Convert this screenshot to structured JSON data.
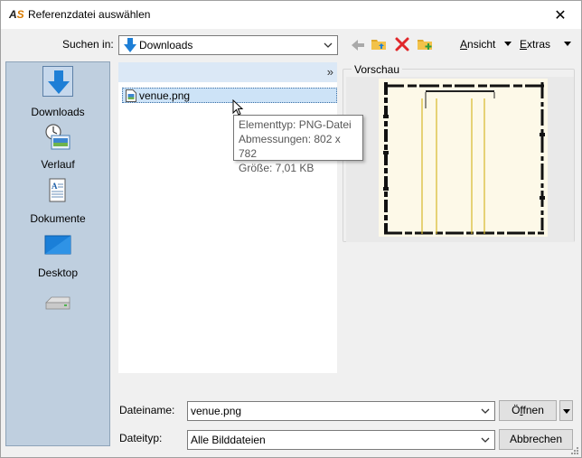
{
  "window": {
    "title": "Referenzdatei auswählen",
    "close_glyph": "✕"
  },
  "toolbar": {
    "look_in_label": "Suchen in:",
    "look_in_value": "Downloads",
    "view_label": "Ansicht",
    "view_mnemonic": "A",
    "view_rest": "nsicht",
    "tools_mnemonic": "E",
    "tools_rest": "xtras",
    "tools_label": "Extras"
  },
  "places": [
    {
      "label": "Downloads",
      "icon": "downloads-arrow-icon",
      "selected": true
    },
    {
      "label": "Verlauf",
      "icon": "history-clock-icon",
      "selected": false
    },
    {
      "label": "Dokumente",
      "icon": "documents-icon",
      "selected": false
    },
    {
      "label": "Desktop",
      "icon": "desktop-icon",
      "selected": false
    },
    {
      "label": "",
      "icon": "drive-icon",
      "selected": false
    }
  ],
  "filelist": {
    "header_chevron": "»",
    "files": [
      {
        "name": "venue.png",
        "icon": "png-file-icon",
        "selected": true
      }
    ]
  },
  "tooltip": {
    "line1": "Elementtyp: PNG-Datei",
    "line2": "Abmessungen: 802 x 782",
    "line3": "Größe: 7,01 KB"
  },
  "preview": {
    "label": "Vorschau"
  },
  "bottom": {
    "filename_label": "Dateiname:",
    "filename_value": "venue.png",
    "filetype_label": "Dateityp:",
    "filetype_value": "Alle Bilddateien",
    "open_mnemonic": "f",
    "open_pre": "Ö",
    "open_post": "fnen",
    "open_label": "Öffnen",
    "cancel_label": "Abbrechen"
  },
  "colors": {
    "places_bg": "#bfcfdf",
    "selection": "#cde3f7",
    "accent_blue": "#1e7fd6",
    "delete_red": "#e0272a",
    "folder_yellow": "#f2c24a"
  }
}
